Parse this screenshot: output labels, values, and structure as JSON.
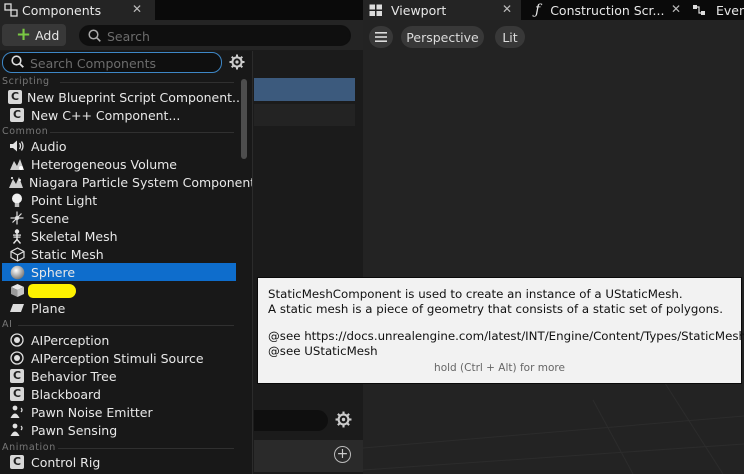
{
  "tabs": {
    "components": {
      "label": "Components"
    },
    "viewport": {
      "label": "Viewport"
    },
    "construction": {
      "label": "Construction Scr..."
    },
    "event": {
      "label": "Even"
    }
  },
  "toolbar": {
    "add_label": "Add",
    "search_placeholder": "Search"
  },
  "dropdown": {
    "search_placeholder": "Search Components",
    "sections": {
      "scripting": "Scripting",
      "common": "Common",
      "ai": "AI",
      "animation": "Animation"
    },
    "items": [
      {
        "label": "New Blueprint Script Component...",
        "icon": "c-class-icon"
      },
      {
        "label": "New C++ Component...",
        "icon": "c-class-icon"
      },
      {
        "label": "Audio",
        "icon": "speaker-icon"
      },
      {
        "label": "Heterogeneous Volume",
        "icon": "volume-icon"
      },
      {
        "label": "Niagara Particle System Component",
        "icon": "niagara-icon"
      },
      {
        "label": "Point Light",
        "icon": "lightbulb-icon"
      },
      {
        "label": "Scene",
        "icon": "scene-icon"
      },
      {
        "label": "Skeletal Mesh",
        "icon": "skeleton-icon"
      },
      {
        "label": "Static Mesh",
        "icon": "static-mesh-icon"
      },
      {
        "label": "Sphere",
        "icon": "sphere-icon",
        "selected": true
      },
      {
        "label": "",
        "icon": "cube-icon",
        "redacted": true
      },
      {
        "label": "Plane",
        "icon": "plane-icon"
      },
      {
        "label": "AIPerception",
        "icon": "perception-icon"
      },
      {
        "label": "AIPerception Stimuli Source",
        "icon": "perception-icon"
      },
      {
        "label": "Behavior Tree",
        "icon": "c-class-icon"
      },
      {
        "label": "Blackboard",
        "icon": "c-class-icon"
      },
      {
        "label": "Pawn Noise Emitter",
        "icon": "pawn-icon"
      },
      {
        "label": "Pawn Sensing",
        "icon": "pawn-icon"
      },
      {
        "label": "Control Rig",
        "icon": "c-class-icon"
      }
    ]
  },
  "viewport": {
    "perspective_label": "Perspective",
    "lit_label": "Lit"
  },
  "tooltip": {
    "line1": "StaticMeshComponent is used to create an instance of a UStaticMesh.",
    "line2": "A static mesh is a piece of geometry that consists of a static set of polygons.",
    "line3": "@see https://docs.unrealengine.com/latest/INT/Engine/Content/Types/StaticMeshes/",
    "line4": "@see UStaticMesh",
    "hint": "hold (Ctrl + Alt) for more"
  },
  "colors": {
    "selection_blue": "#0e6dcc",
    "tree_selection": "#3c5a7d",
    "add_plus_green": "#7ac943",
    "highlight_yellow": "#fdf200"
  }
}
